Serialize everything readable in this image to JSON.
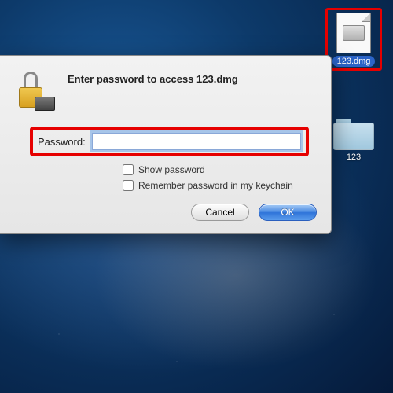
{
  "desktop": {
    "dmg_file_label": "123.dmg",
    "folder_label": "123"
  },
  "dialog": {
    "title": "Enter password to access 123.dmg",
    "password_label": "Password:",
    "password_value": "",
    "password_placeholder": "",
    "show_password_label": "Show password",
    "remember_label": "Remember password in my keychain",
    "cancel_label": "Cancel",
    "ok_label": "OK"
  },
  "annotations": {
    "dmg_highlight_color": "#e60000",
    "password_highlight_color": "#e60000"
  }
}
